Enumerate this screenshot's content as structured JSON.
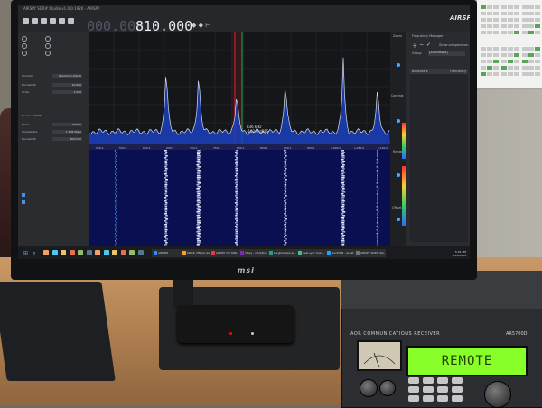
{
  "monitor": {
    "brand": "msi"
  },
  "app": {
    "window_title": "AIRSPY SDR# Studio v1.0.0.1920 - AIRSPY",
    "frequency_dim": "000.000",
    "frequency": "810.000",
    "logo": "AIRSPY",
    "left_panel": {
      "rows": [
        {
          "label": "Window",
          "value": "Blackman-Harris"
        },
        {
          "label": "Bandwidth",
          "value": "10,000"
        },
        {
          "label": "Order",
          "value": "1,000"
        },
        {
          "label": "Source: AIRSPY",
          "value": ""
        },
        {
          "label": "Model",
          "value": "AIRSPY"
        },
        {
          "label": "Samplerate",
          "value": "1.536 Msps"
        },
        {
          "label": "Bandwidth",
          "value": "800 kHz"
        }
      ]
    },
    "spectrum": {
      "cursor_freq": "836 kHz",
      "cursor_level": "-102.0 dBFS",
      "axis_ticks": [
        "500 k",
        "550 k",
        "600 k",
        "650 k",
        "700 k",
        "750 k",
        "800 k",
        "850 k",
        "900 k",
        "950 k",
        "1,000 k",
        "1,050 k",
        "1,100 k"
      ]
    },
    "zoom_label": "Zoom",
    "contrast_label": "Contrast",
    "range_label": "Range",
    "offset_label": "Offset",
    "frequency_manager": {
      "title": "Frequency Manager",
      "show_on_spectrum": "Show on spectrum",
      "group_label": "Group",
      "group_value": "[All Groups]",
      "col_bookmark": "Bookmark",
      "col_frequency": "Frequency"
    },
    "taskbar": {
      "tasks": [
        "AIRSDR",
        "SDR# official rele...",
        "AIRSPY DX SDR...",
        "nfreq - mod(Dou...",
        "sorgtionales de...",
        "new sysc tools...",
        "NordVPN - Avast",
        "AIRSPY SDR# Stu..."
      ],
      "time": "5:01 PM",
      "date": "6/14/2024"
    }
  },
  "radio": {
    "display": "REMOTE",
    "brand": "AOR COMMUNICATIONS RECEIVER",
    "model": "AR5700D"
  }
}
